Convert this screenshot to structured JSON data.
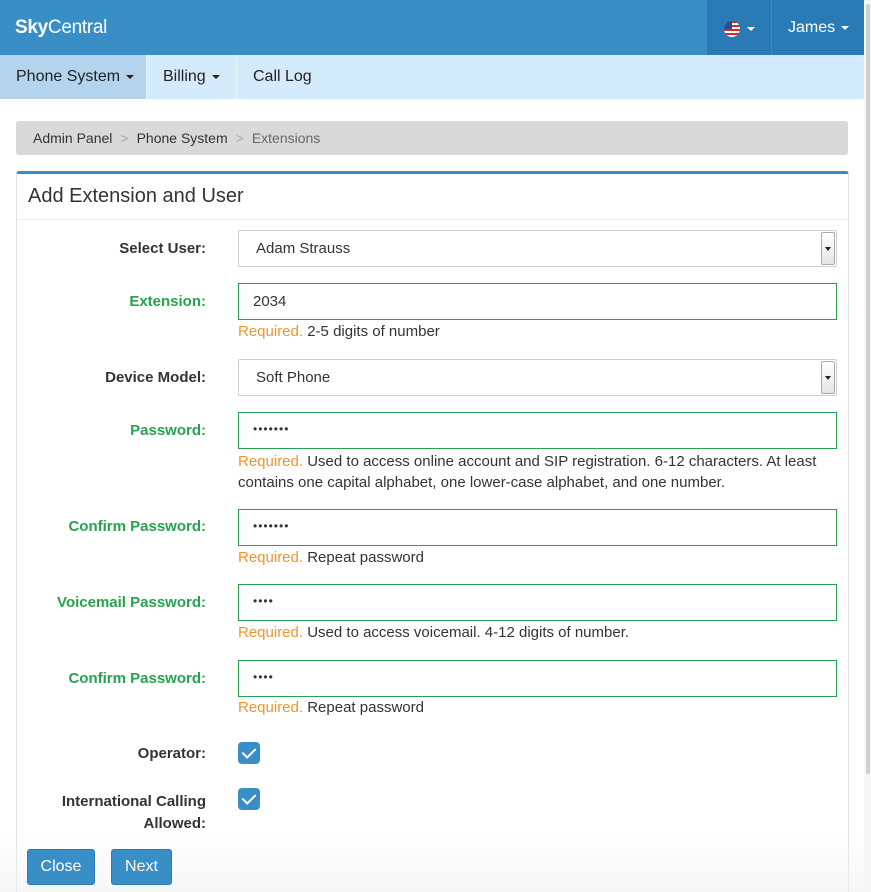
{
  "app": {
    "brand_bold": "Sky",
    "brand_rest": "Central"
  },
  "header": {
    "user_name": "James",
    "language_icon": "us-flag-icon"
  },
  "nav": {
    "items": [
      {
        "label": "Phone System",
        "dropdown": true
      },
      {
        "label": "Billing",
        "dropdown": true
      },
      {
        "label": "Call Log",
        "dropdown": false
      }
    ]
  },
  "breadcrumb": {
    "items": [
      "Admin Panel",
      "Phone System",
      "Extensions"
    ],
    "separator": ">"
  },
  "panel": {
    "title": "Add Extension and User"
  },
  "form": {
    "select_user": {
      "label": "Select User:",
      "value": "Adam Strauss"
    },
    "extension": {
      "label": "Extension:",
      "value": "2034",
      "required": "Required.",
      "help": "2-5 digits of number"
    },
    "device_model": {
      "label": "Device Model:",
      "value": "Soft Phone"
    },
    "password": {
      "label": "Password:",
      "value": "•••••••",
      "required": "Required.",
      "help": "Used to access online account and SIP registration. 6-12 characters. At least contains one capital alphabet, one lower-case alphabet, and one number."
    },
    "confirm_password": {
      "label": "Confirm Password:",
      "value": "•••••••",
      "required": "Required.",
      "help": "Repeat password"
    },
    "voicemail_password": {
      "label": "Voicemail Password:",
      "value": "••••",
      "required": "Required.",
      "help": "Used to access voicemail. 4-12 digits of number."
    },
    "confirm_voicemail_password": {
      "label": "Confirm Password:",
      "value": "••••",
      "required": "Required.",
      "help": "Repeat password"
    },
    "operator": {
      "label": "Operator:",
      "checked": true
    },
    "international": {
      "label_line1": "International Calling",
      "label_line2": "Allowed:",
      "checked": true
    }
  },
  "buttons": {
    "close": "Close",
    "next": "Next"
  },
  "colors": {
    "primary": "#3a8ec6",
    "nav_bg": "#d4ebfb",
    "valid": "#27a34f",
    "required": "#f0952b"
  }
}
